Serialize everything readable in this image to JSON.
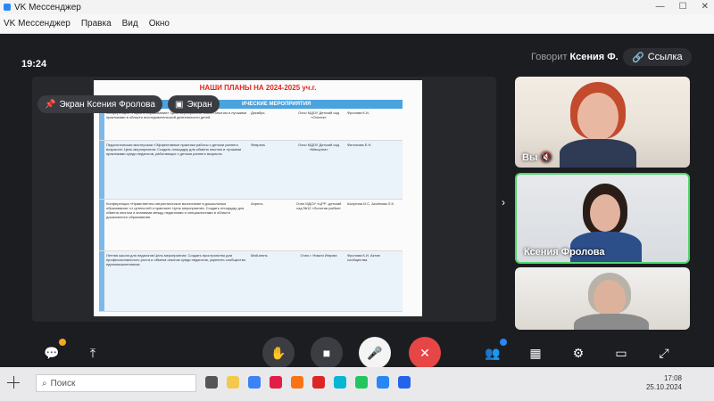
{
  "window": {
    "title": "VK Мессенджер",
    "menu": [
      "Правка",
      "Вид",
      "Окно"
    ],
    "menu_first": "VK Мессенджер"
  },
  "call": {
    "time": "19:24",
    "speaker_prefix": "Говорит",
    "speaker_name": "Ксения Ф.",
    "link_label": "Ссылка",
    "screen_chip": "Экран Ксения Фролова",
    "screen_chip2": "Экран"
  },
  "slide": {
    "title": "НАШИ ПЛАНЫ НА 2024-2025 уч.г.",
    "header": "ИЧЕСКИЕ МЕРОПРИЯТИЯ",
    "rows": [
      {
        "c1": "Конференция «Наука в образовании» Цель мероприятия: обмен опытом и лучшими практиками в области исследовательской деятельности детей.",
        "c2": "Декабрь",
        "c3": "Очно МДОУ Детский сад «Огонек»",
        "c4": "Фролова К.И."
      },
      {
        "c1": "Педагогическая мастерская «Эффективные практики работы с детьми раннего возраста» Цель мероприятия: Создать площадку для обмена опытом и лучшими практиками среди педагогов, работающих с детьми раннего возраста.",
        "c2": "Февраль",
        "c3": "Очно МДОУ Детский сад «Мишутка»",
        "c4": "Филонова Е.Н."
      },
      {
        "c1": "Конференция «Нравственно-патриотическое воспитание в дошкольном образовании: от ценностей к практике» Цель мероприятия: Создать площадку для обмена опытом и знаниями между педагогами и специалистами в области дошкольного образования.",
        "c2": "Апрель",
        "c3": "Очно МДОУ «ЦРР -детский сад №12 «Золотая рыбка»",
        "c4": "Калугина И.С. Аксёнова Л.К."
      },
      {
        "c1": "Летняя школа для педагогов Цель мероприятия: Создать пространство для профессионального роста и обмена опытом среди педагогов, укрепить сообщество единомышленников.",
        "c2": "Май-июнь",
        "c3": "Очно г. Нижня Игирма",
        "c4": "Фролова К.И. Актив сообщества"
      }
    ]
  },
  "participants": [
    {
      "name": "Вы",
      "muted": true
    },
    {
      "name": "Ксения Фролова",
      "muted": false
    },
    {
      "name": "",
      "muted": false
    }
  ],
  "taskbar": {
    "search_placeholder": "Поиск",
    "time": "17:08",
    "date": "25.10.2024"
  },
  "colors": {
    "active_speaker_border": "#4fd66d",
    "end_call": "#e64646",
    "accent": "#2787f5",
    "slide_title": "#e1261c"
  }
}
